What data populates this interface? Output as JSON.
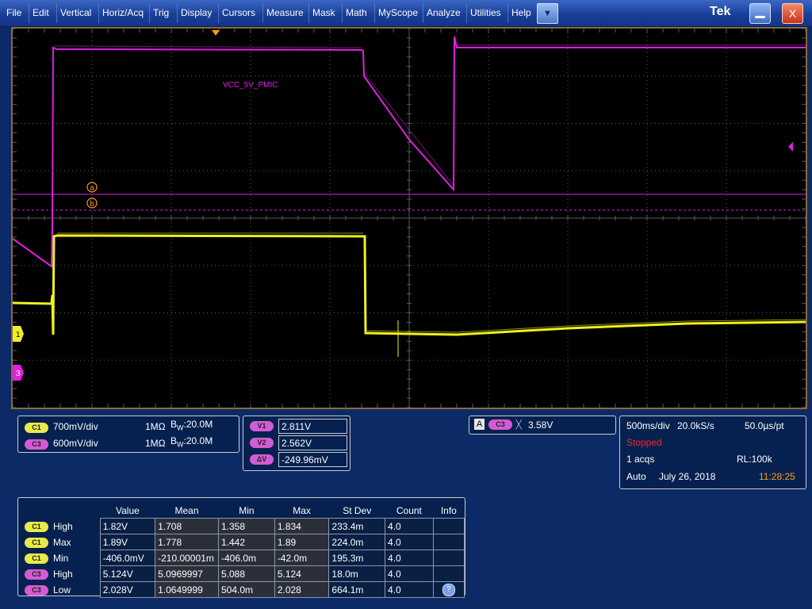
{
  "menu": {
    "items": [
      "File",
      "Edit",
      "Vertical",
      "Horiz/Acq",
      "Trig",
      "Display",
      "Cursors",
      "Measure",
      "Mask",
      "Math",
      "MyScope",
      "Analyze",
      "Utilities",
      "Help"
    ],
    "brand": "Tek",
    "close_label": "X",
    "dropdown_label": "▼"
  },
  "waveform": {
    "label": "VCC_5V_PMIC",
    "cursor_a": "a",
    "cursor_b": "b",
    "ch1_marker": "1",
    "ch3_marker": "3"
  },
  "colors": {
    "ch1": "#f0f020",
    "ch3": "#e020e0",
    "cursor": "#ff9a1a",
    "grid": "#5a5a5a"
  },
  "channels": [
    {
      "pill": "C1",
      "scale": "700mV/div",
      "impedance": "1MΩ",
      "bw_prefix": "B",
      "bw_sub": "W",
      "bw": ":20.0M"
    },
    {
      "pill": "C3",
      "scale": "600mV/div",
      "impedance": "1MΩ",
      "bw_prefix": "B",
      "bw_sub": "W",
      "bw": ":20.0M"
    }
  ],
  "cursors_readout": {
    "v1_label": "V1",
    "v1": "2.811V",
    "v2_label": "V2",
    "v2": "2.562V",
    "dv_label": "ΔV",
    "dv": "-249.96mV"
  },
  "trigger": {
    "mode_letter": "A",
    "source": "C3",
    "slope_glyph": "ᚷ",
    "level": "3.58V"
  },
  "acquisition": {
    "timebase": "500ms/div",
    "sample_rate": "20.0kS/s",
    "point_interval": "50.0µs/pt",
    "state": "Stopped",
    "acqs": "1 acqs",
    "record_length": "RL:100k",
    "mode": "Auto",
    "date": "July 26, 2018",
    "time": "11:28:25"
  },
  "measurements": {
    "headers": [
      "Value",
      "Mean",
      "Min",
      "Max",
      "St Dev",
      "Count",
      "Info"
    ],
    "rows": [
      {
        "source": "C1",
        "type": "High",
        "cells": [
          "1.82V",
          "1.708",
          "1.358",
          "1.834",
          "233.4m",
          "4.0",
          ""
        ]
      },
      {
        "source": "C1",
        "type": "Max",
        "cells": [
          "1.89V",
          "1.778",
          "1.442",
          "1.89",
          "224.0m",
          "4.0",
          ""
        ]
      },
      {
        "source": "C1",
        "type": "Min",
        "cells": [
          "-406.0mV",
          "-210.00001m",
          "-406.0m",
          "-42.0m",
          "195.3m",
          "4.0",
          ""
        ]
      },
      {
        "source": "C3",
        "type": "High",
        "cells": [
          "5.124V",
          "5.0969997",
          "5.088",
          "5.124",
          "18.0m",
          "4.0",
          ""
        ]
      },
      {
        "source": "C3",
        "type": "Low",
        "cells": [
          "2.028V",
          "1.0649999",
          "504.0m",
          "2.028",
          "664.1m",
          "4.0",
          ""
        ]
      }
    ],
    "info_icon": "?"
  }
}
